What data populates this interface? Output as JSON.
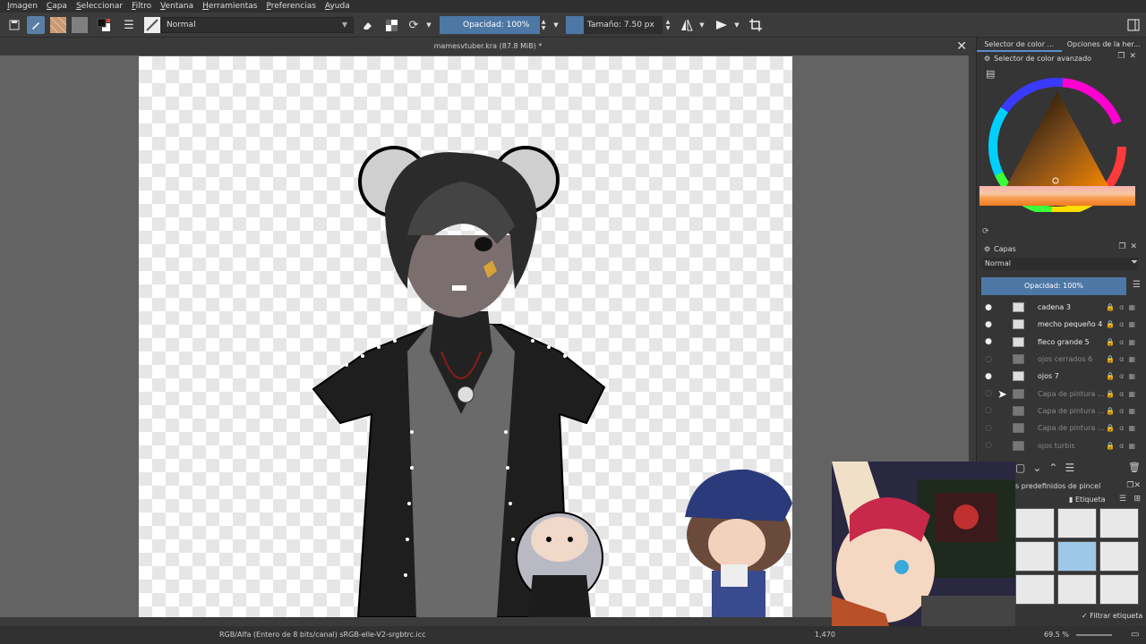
{
  "menu": [
    "Imagen",
    "Capa",
    "Seleccionar",
    "Filtro",
    "Ventana",
    "Herramientas",
    "Preferencias",
    "Ayuda"
  ],
  "toolbar": {
    "blend_mode": "Normal",
    "opacity_label": "Opacidad: 100%",
    "size_label": "Tamaño: 7.50 px"
  },
  "document": {
    "title": "mamesvtuber.kra (87.8 MiB) *"
  },
  "status": {
    "color_space": "RGB/Alfa (Entero de 8 bits/canal)  sRGB-elle-V2-srgbtrc.icc",
    "coords": "1,470",
    "zoom": "69.5 %"
  },
  "dock": {
    "tabs": [
      "Selector de color ...",
      "Opciones de la her..."
    ],
    "color_selector_title": "Selector de color avanzado",
    "layers_title": "Capas",
    "layers_blend": "Normal",
    "layers_opacity": "Opacidad:  100%",
    "layers": [
      {
        "name": "cadena 3",
        "visible": true
      },
      {
        "name": "mecho pequeño 4",
        "visible": true
      },
      {
        "name": "fleco grande 5",
        "visible": true
      },
      {
        "name": "ojos cerrados 6",
        "visible": false
      },
      {
        "name": "ojos 7",
        "visible": true
      },
      {
        "name": "Capa de pintura ...",
        "visible": false
      },
      {
        "name": "Capa de pintura ...",
        "visible": false
      },
      {
        "name": "Capa de pintura ...",
        "visible": false
      },
      {
        "name": "ojos turbis",
        "visible": false
      }
    ],
    "brush_presets_title": "s predefinidos de pincel",
    "brush_tag_label": "Etiqueta",
    "filter_tag_label": "Filtrar etiqueta"
  },
  "colors": {
    "accent": "#4d77a5",
    "panel": "#353535"
  }
}
